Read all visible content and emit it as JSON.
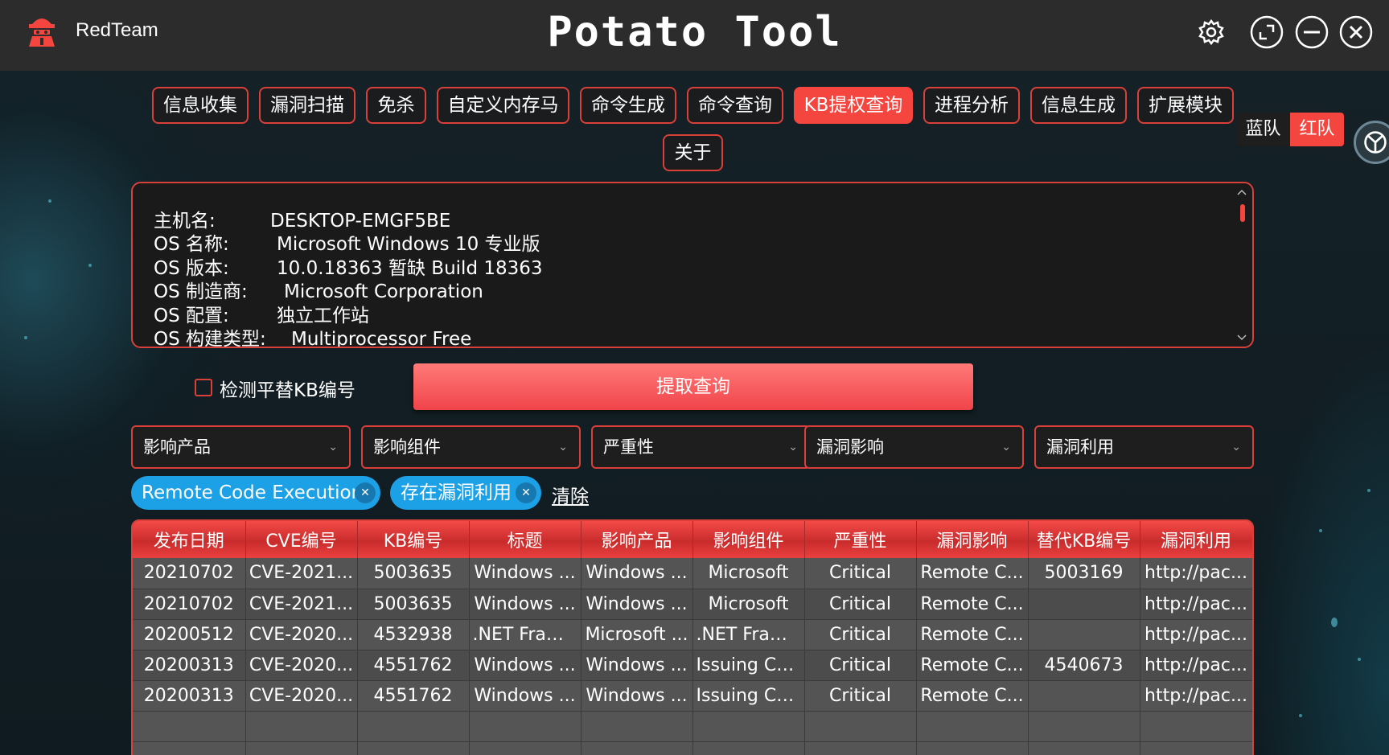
{
  "window": {
    "brand": "RedTeam",
    "title": "Potato Tool"
  },
  "nav": {
    "tabs": [
      {
        "label": "信息收集",
        "active": false
      },
      {
        "label": "漏洞扫描",
        "active": false
      },
      {
        "label": "免杀",
        "active": false
      },
      {
        "label": "自定义内存马",
        "active": false
      },
      {
        "label": "命令生成",
        "active": false
      },
      {
        "label": "命令查询",
        "active": false
      },
      {
        "label": "KB提权查询",
        "active": true
      },
      {
        "label": "进程分析",
        "active": false
      },
      {
        "label": "信息生成",
        "active": false
      },
      {
        "label": "扩展模块",
        "active": false
      },
      {
        "label": "关于",
        "active": false
      }
    ],
    "team": {
      "blue": "蓝队",
      "red": "红队",
      "selected": "红队"
    }
  },
  "sysinfo": {
    "lines": [
      {
        "key": "主机名:",
        "value": "DESKTOP-EMGF5BE"
      },
      {
        "key": "OS 名称:",
        "value": "Microsoft Windows 10 专业版"
      },
      {
        "key": "OS 版本:",
        "value": "10.0.18363 暂缺 Build 18363"
      },
      {
        "key": "OS 制造商:",
        "value": "Microsoft Corporation"
      },
      {
        "key": "OS 配置:",
        "value": "独立工作站"
      },
      {
        "key": "OS 构建类型:",
        "value": "Multiprocessor Free"
      }
    ]
  },
  "controls": {
    "checkbox_label": "检测平替KB编号",
    "checkbox_checked": false,
    "query_button": "提取查询"
  },
  "filters": [
    "影响产品",
    "影响组件",
    "严重性",
    "漏洞影响",
    "漏洞利用"
  ],
  "chips": [
    "Remote Code Execution",
    "存在漏洞利用"
  ],
  "clear_label": "清除",
  "table": {
    "headers": [
      "发布日期",
      "CVE编号",
      "KB编号",
      "标题",
      "影响产品",
      "影响组件",
      "严重性",
      "漏洞影响",
      "替代KB编号",
      "漏洞利用"
    ],
    "rows": [
      [
        "20210702",
        "CVE-2021...",
        "5003635",
        "Windows ...",
        "Windows ...",
        "Microsoft",
        "Critical",
        "Remote C...",
        "5003169",
        "http://pac..."
      ],
      [
        "20210702",
        "CVE-2021...",
        "5003635",
        "Windows ...",
        "Windows ...",
        "Microsoft",
        "Critical",
        "Remote C...",
        "",
        "http://pac..."
      ],
      [
        "20200512",
        "CVE-2020...",
        "4532938",
        ".NET Fram...",
        "Microsoft ...",
        ".NET Fram...",
        "Critical",
        "Remote C...",
        "",
        "http://pac..."
      ],
      [
        "20200313",
        "CVE-2020...",
        "4551762",
        "Windows ...",
        "Windows ...",
        "Issuing CNA",
        "Critical",
        "Remote C...",
        "4540673",
        "http://pac..."
      ],
      [
        "20200313",
        "CVE-2020...",
        "4551762",
        "Windows ...",
        "Windows ...",
        "Issuing CNA",
        "Critical",
        "Remote C...",
        "",
        "http://pac..."
      ]
    ]
  },
  "colors": {
    "accent_red": "#f4453f",
    "chip_blue": "#1da1e6",
    "titlebar": "#2c2c2c"
  }
}
